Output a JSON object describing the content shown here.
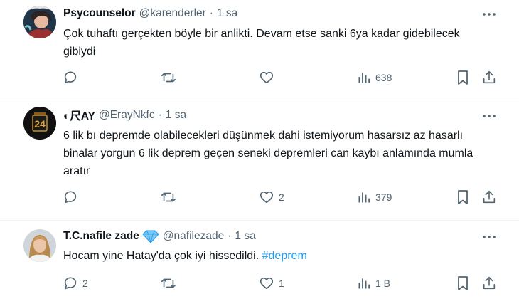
{
  "tweets": [
    {
      "name": "Psycounselor",
      "handle": "@karenderler",
      "separator": "·",
      "time": "1 sa",
      "text": "Çok tuhaftı gerçekten böyle bir anlikti. Devam etse sanki 6ya kadar gidebilecek gibiydi",
      "replies": "",
      "retweets": "",
      "likes": "",
      "views": "638"
    },
    {
      "name": "◐尺AY",
      "handle": "@ErayNkfc",
      "separator": "·",
      "time": "1 sa",
      "text": "6 lik bı depremde olabilecekleri düşünmek dahi istemiyorum hasarsız az hasarlı binalar yorgun 6 lik deprem geçen seneki depremleri can kaybı anlamında mumla aratır",
      "replies": "",
      "retweets": "",
      "likes": "2",
      "views": "379"
    },
    {
      "name": "T.C.nafile zade",
      "handle": "@nafilezade",
      "separator": "·",
      "time": "1 sa",
      "text": "Hocam yine Hatay'da çok iyi hissedildi. ",
      "hashtag": "#deprem",
      "replies": "2",
      "retweets": "",
      "likes": "1",
      "views": "1 B"
    }
  ],
  "colors": {
    "text": "#0f1419",
    "muted": "#536471",
    "link": "#1d9bf0",
    "divider": "#eff3f4",
    "verified": "#1d9bf0"
  },
  "icons": [
    "avatar",
    "more-icon",
    "reply-icon",
    "retweet-icon",
    "like-icon",
    "views-icon",
    "bookmark-icon",
    "share-icon",
    "verified-badge-icon"
  ]
}
